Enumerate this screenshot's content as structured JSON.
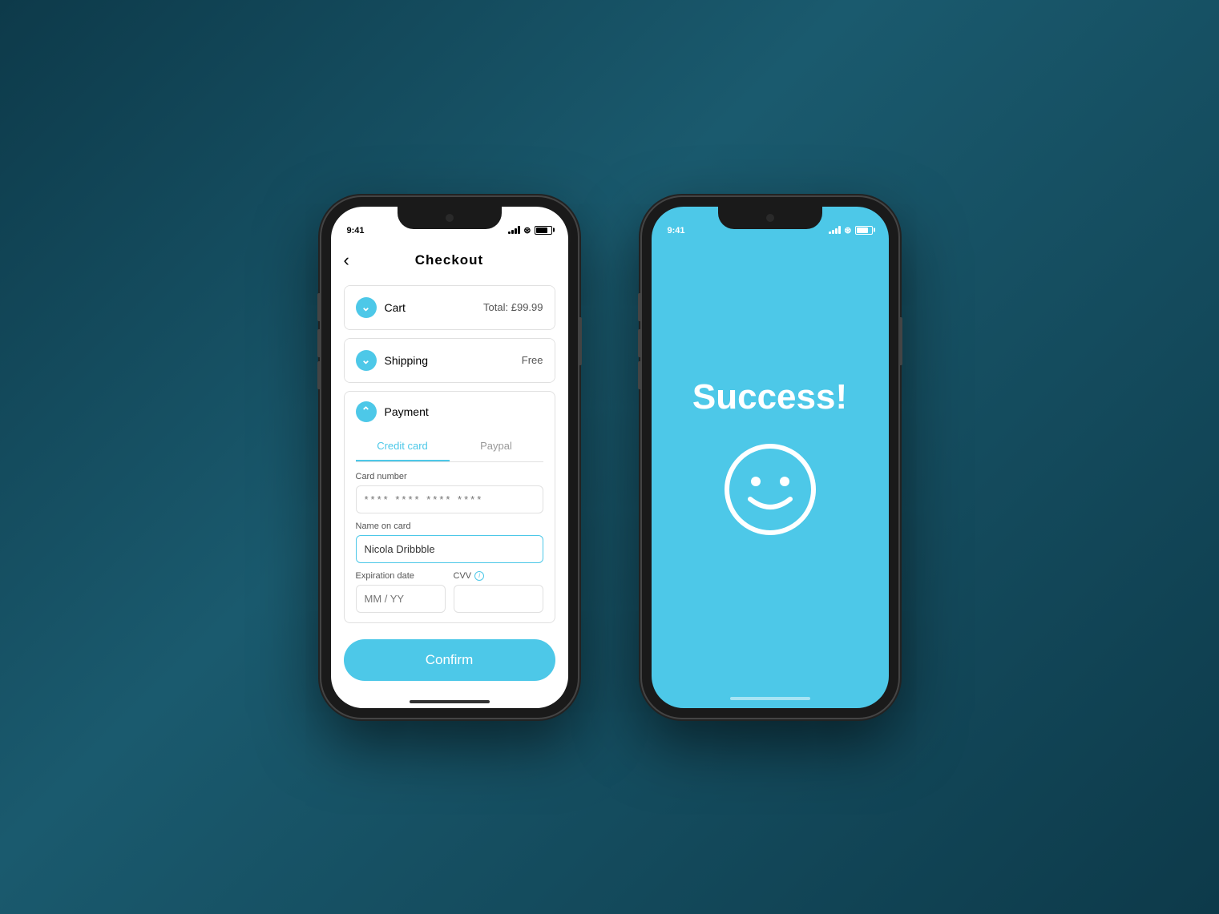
{
  "background": "#0d3a4a",
  "phone1": {
    "statusBar": {
      "time": "9:41",
      "theme": "dark"
    },
    "header": {
      "backLabel": "‹",
      "title": "Checkout"
    },
    "cart": {
      "label": "Cart",
      "value": "Total: £99.99",
      "icon": "chevron-down"
    },
    "shipping": {
      "label": "Shipping",
      "value": "Free",
      "icon": "chevron-down"
    },
    "payment": {
      "label": "Payment",
      "icon": "chevron-up",
      "tabs": [
        "Credit card",
        "Paypal"
      ],
      "activeTab": 0,
      "cardNumberLabel": "Card number",
      "cardNumberPlaceholder": "**** **** **** ****",
      "nameLabel": "Name on card",
      "nameValue": "Nicola Dribbble",
      "expirationLabel": "Expiration date",
      "expirationPlaceholder": "MM / YY",
      "cvvLabel": "CVV"
    },
    "confirmButton": "Confirm"
  },
  "phone2": {
    "statusBar": {
      "time": "9:41",
      "theme": "light"
    },
    "successTitle": "Success!",
    "emojiAlt": "smiley face"
  }
}
